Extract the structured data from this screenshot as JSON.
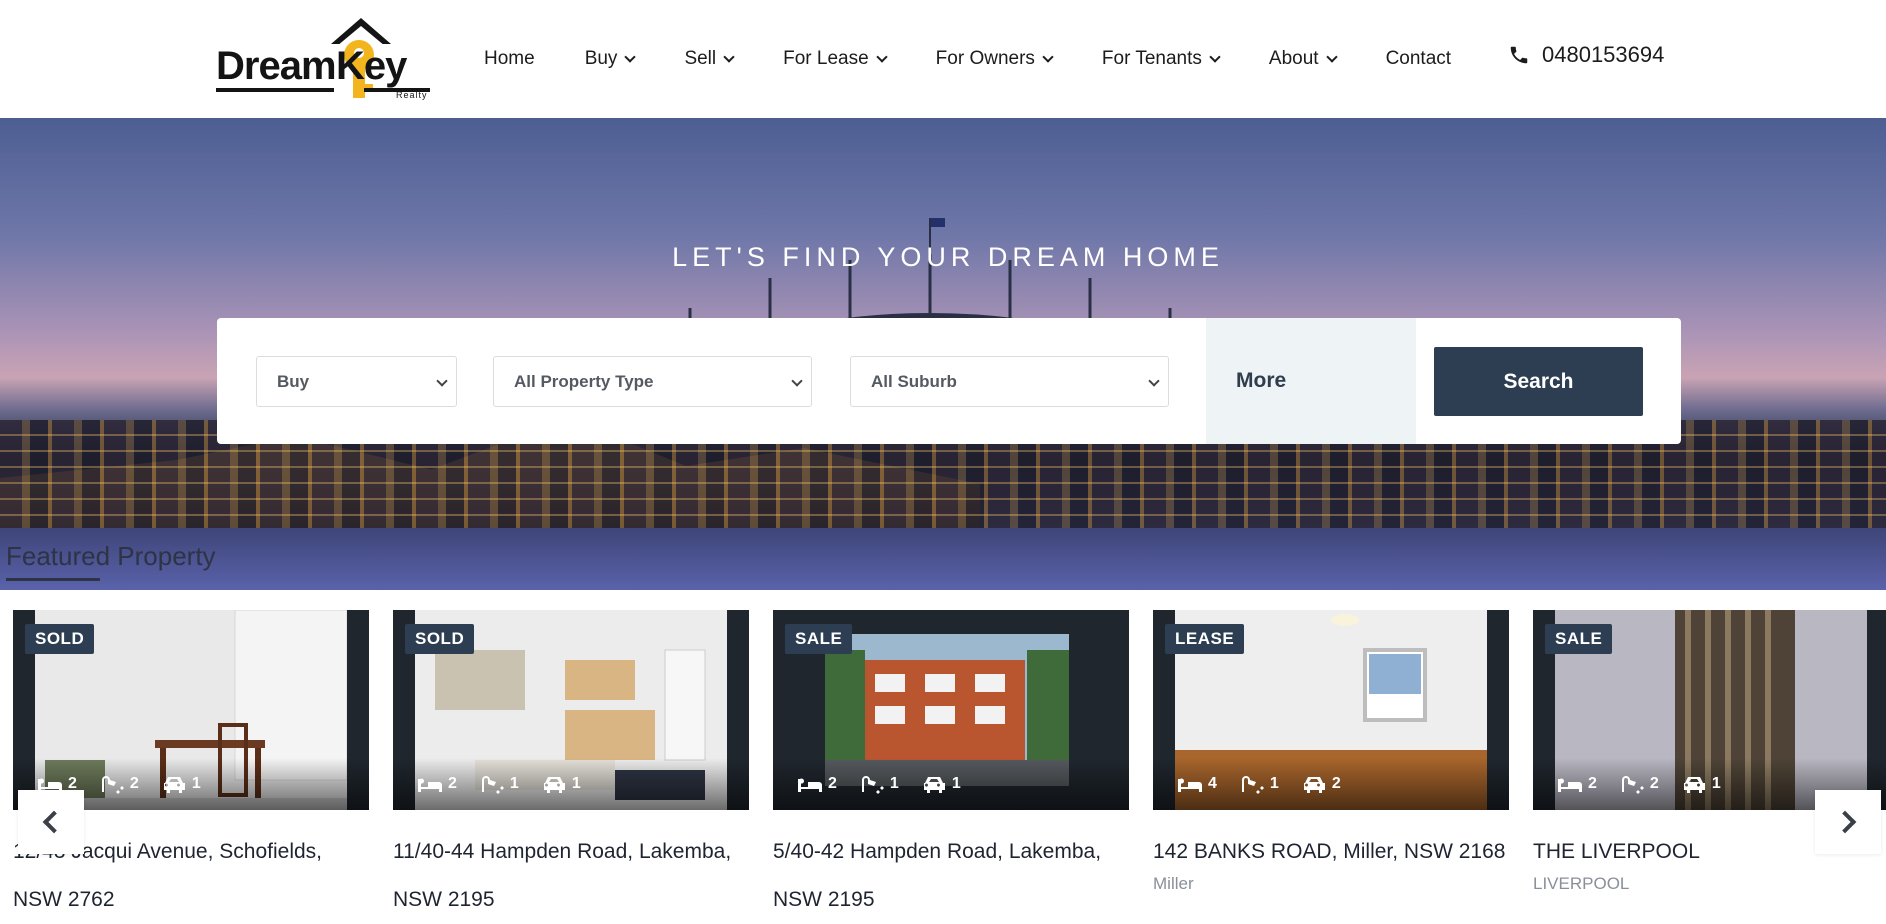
{
  "brand": {
    "name_left": "Dream",
    "name_right": "Key",
    "tagline": "Realty"
  },
  "nav": {
    "items": [
      {
        "label": "Home",
        "dropdown": false
      },
      {
        "label": "Buy",
        "dropdown": true
      },
      {
        "label": "Sell",
        "dropdown": true
      },
      {
        "label": "For Lease",
        "dropdown": true
      },
      {
        "label": "For Owners",
        "dropdown": true
      },
      {
        "label": "For Tenants",
        "dropdown": true
      },
      {
        "label": "About",
        "dropdown": true
      },
      {
        "label": "Contact",
        "dropdown": false
      }
    ],
    "phone": "0480153694",
    "phone_icon": "phone-icon"
  },
  "hero": {
    "title": "LET'S FIND YOUR DREAM HOME"
  },
  "search": {
    "mode": "Buy",
    "property_type": "All Property Type",
    "suburb": "All Suburb",
    "more_label": "More",
    "button_label": "Search"
  },
  "featured": {
    "heading": "Featured Property"
  },
  "listings": [
    {
      "badge": "SOLD",
      "beds": "2",
      "baths": "2",
      "cars": "1",
      "address": "12/43 Jacqui Avenue, Schofields, NSW 2762",
      "suburb": ""
    },
    {
      "badge": "SOLD",
      "beds": "2",
      "baths": "1",
      "cars": "1",
      "address": "11/40-44 Hampden Road, Lakemba, NSW 2195",
      "suburb": ""
    },
    {
      "badge": "SALE",
      "beds": "2",
      "baths": "1",
      "cars": "1",
      "address": "5/40-42 Hampden Road, Lakemba, NSW 2195",
      "suburb": ""
    },
    {
      "badge": "LEASE",
      "beds": "4",
      "baths": "1",
      "cars": "2",
      "address": "142 BANKS ROAD, Miller, NSW 2168",
      "suburb": "Miller"
    },
    {
      "badge": "SALE",
      "beds": "2",
      "baths": "2",
      "cars": "1",
      "address": "THE LIVERPOOL",
      "suburb": "LIVERPOOL"
    }
  ],
  "carousel": {
    "prev_icon": "chevron-left-icon",
    "next_icon": "chevron-right-icon"
  },
  "colors": {
    "brand_dark": "#2d3e52",
    "brand_key": "#f2b51d",
    "more_bg": "#eef3f6"
  }
}
